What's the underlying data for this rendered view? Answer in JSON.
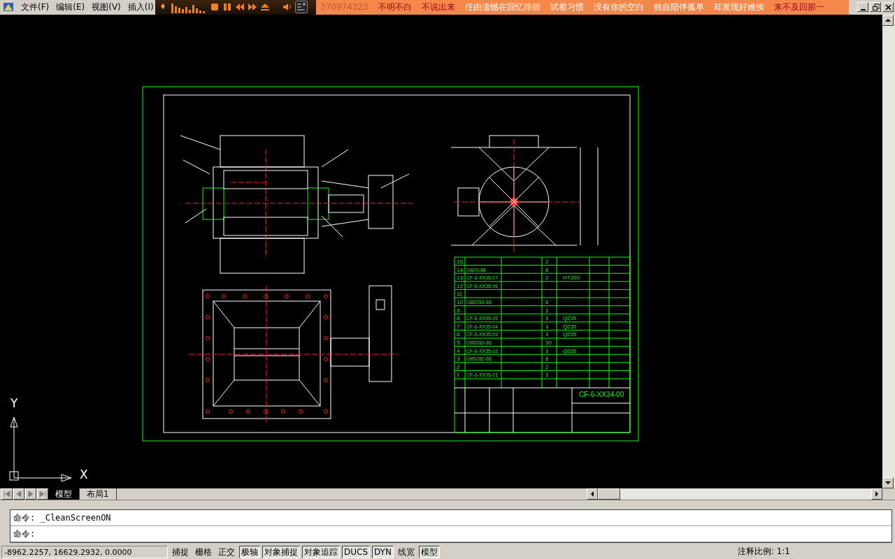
{
  "menu": [
    {
      "label": "文件(F)"
    },
    {
      "label": "编辑(E)"
    },
    {
      "label": "视图(V)"
    },
    {
      "label": "插入(I)"
    }
  ],
  "player": {
    "qq": "370974323",
    "lyrics": [
      {
        "text": "不明不白",
        "highlighted": true
      },
      {
        "text": "不说出来",
        "highlighted": true
      },
      {
        "text": "任由遗憾在回忆徘徊",
        "highlighted": false
      },
      {
        "text": "试着习惯",
        "highlighted": false
      },
      {
        "text": "没有你的空白",
        "highlighted": false
      },
      {
        "text": "独自陪伴孤单",
        "highlighted": false
      },
      {
        "text": "却发现好难挨",
        "highlighted": false
      },
      {
        "text": "来不及回那一",
        "highlighted": true
      }
    ]
  },
  "drawing": {
    "parts": [
      {
        "no": "15",
        "qty": "2"
      },
      {
        "no": "14",
        "code": "GB70-85",
        "qty": "8"
      },
      {
        "no": "13",
        "code": "CF-6-XX35-07",
        "qty": "2",
        "material": "HT200"
      },
      {
        "no": "12",
        "code": "CF-6-XX35-06"
      },
      {
        "no": "11"
      },
      {
        "no": "10",
        "code": "GB5783-86",
        "qty": "8"
      },
      {
        "no": "9",
        "qty": "1"
      },
      {
        "no": "8",
        "code": "CF-6-XX35-05",
        "qty": "1",
        "material": "Q235"
      },
      {
        "no": "7",
        "code": "CF-6-XX35-04",
        "qty": "1",
        "material": "Q235"
      },
      {
        "no": "6",
        "code": "CF-6-XX35-03",
        "qty": "1",
        "material": "Q235"
      },
      {
        "no": "5",
        "code": "GB5783-86",
        "qty": "30"
      },
      {
        "no": "4",
        "code": "CF-6-XX35-02",
        "qty": "1",
        "material": "Q235"
      },
      {
        "no": "3",
        "code": "GB5782-86",
        "qty": "8"
      },
      {
        "no": "2",
        "qty": "2"
      },
      {
        "no": "1",
        "code": "CF-6-XX35-01",
        "qty": "1"
      }
    ],
    "title_code": "CF-6-XX34-00"
  },
  "ucs": {
    "y_label": "Y",
    "x_label": "X"
  },
  "tabs": [
    {
      "label": "模型",
      "selected": true
    },
    {
      "label": "布局1",
      "selected": false
    }
  ],
  "command_lines": [
    "命令: _CleanScreenON",
    "命令:"
  ],
  "status_bar": {
    "coordinates": "-8962.2257, 16629.2932, 0.0000",
    "toggles": [
      {
        "label": "捕捉",
        "on": false
      },
      {
        "label": "栅格",
        "on": false
      },
      {
        "label": "正交",
        "on": false
      },
      {
        "label": "极轴",
        "on": true
      },
      {
        "label": "对象捕捉",
        "on": true
      },
      {
        "label": "对象追踪",
        "on": true
      },
      {
        "label": "DUCS",
        "on": true
      },
      {
        "label": "DYN",
        "on": true
      },
      {
        "label": "线宽",
        "on": false
      },
      {
        "label": "模型",
        "on": true
      }
    ],
    "scale_label": "注释比例:",
    "scale_value": "1:1"
  }
}
